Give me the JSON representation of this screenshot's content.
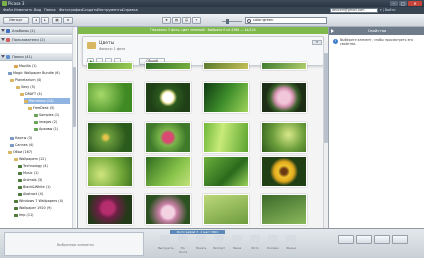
{
  "window": {
    "title": "Picasa 3"
  },
  "menu": [
    "Файл",
    "Изменить",
    "Вид",
    "Папка",
    "Фотография",
    "Создать",
    "Инструменты",
    "Справка"
  ],
  "account": {
    "email": "devcom@gmail.com",
    "links": "▾ | Выйти"
  },
  "toolbar": {
    "import_label": "Импорт",
    "search_value": "color:green"
  },
  "status_green": "Показаны 3 фото, цвет зеленый  ·  Выбрано 0 из 4368 — 44/124",
  "left": {
    "sections": [
      {
        "label": "Альбомы (2)",
        "color": "#3f6fbf"
      },
      {
        "label": "Пользователи (2)",
        "color": "#d05f5f"
      },
      {
        "label": "Папки (41)",
        "color": "#5c8fd3"
      }
    ],
    "folders": [
      "Mozilla (1)",
      "Magic Wallpaper Bundle (6)",
      "Planetarium (4)",
      "Sexy (5)",
      "DRAFT (4)",
      "Растения (14)",
      "FreeDesk (5)",
      "Samples (1)",
      "images (2)",
      "Архивы (1)",
      "Карты (3)",
      "Cannes (4)",
      "Обои (167)",
      "Wallpapers (12)",
      "Technology (4)",
      "Music (1)",
      "Animals (3)",
      "Black&White (1)",
      "Abstract (4)",
      "Windows 7 Wallpapers (4)",
      "Wallpaper 1920 (9)",
      "Imp (11)"
    ]
  },
  "center": {
    "folder_title": "Цветы",
    "folder_sub": "Фильтр: 1 фото",
    "share_label": "Общий доступ"
  },
  "right": {
    "header": "Свойства",
    "text": "Выберите элемент, чтобы просмотреть его свойства."
  },
  "bottom": {
    "selection_text": "Выбранные элементы",
    "info_chip": "Фотографий 3 · 4 мест 3901",
    "actions": [
      "Выгрузить",
      "Эл. почта",
      "Печать",
      "Экспорт",
      "Заказ",
      "Фото",
      "Коллаж",
      "Фильм"
    ]
  }
}
